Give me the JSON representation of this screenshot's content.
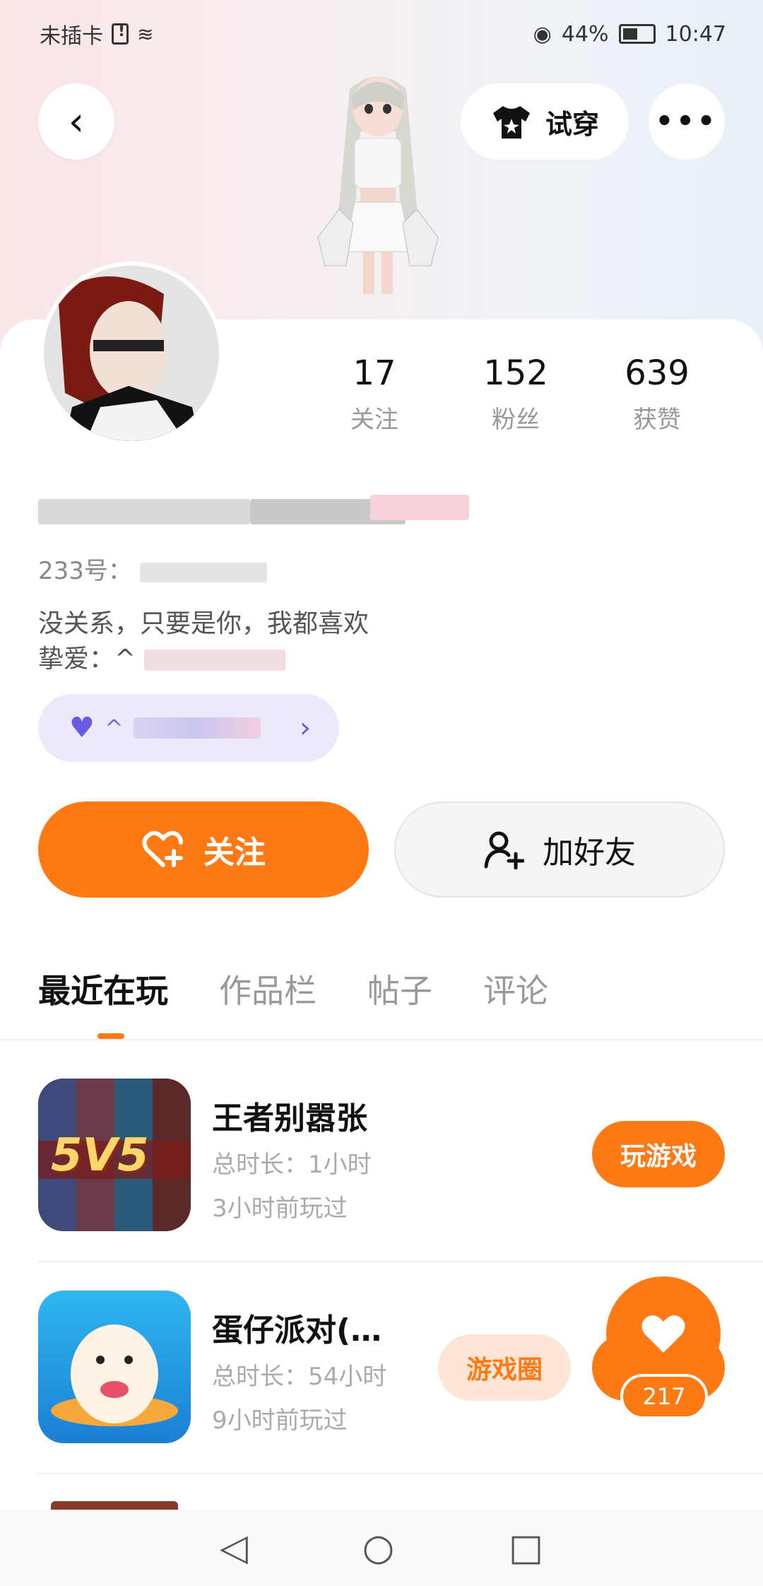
{
  "status_bar": {
    "carrier": "未插卡",
    "battery_percent": "44%",
    "time": "10:47"
  },
  "header": {
    "tryon_label": "试穿"
  },
  "stats": [
    {
      "value": "17",
      "label": "关注"
    },
    {
      "value": "152",
      "label": "粉丝"
    },
    {
      "value": "639",
      "label": "获赞"
    }
  ],
  "profile": {
    "id_label": "233号：",
    "bio_line1": "没关系，只要是你，我都喜欢",
    "bio_line2": "挚爱：^"
  },
  "friend_pill_prefix": "^",
  "actions": {
    "follow_label": "关注",
    "add_friend_label": "加好友"
  },
  "tabs": [
    {
      "label": "最近在玩",
      "active": true
    },
    {
      "label": "作品栏",
      "active": false
    },
    {
      "label": "帖子",
      "active": false
    },
    {
      "label": "评论",
      "active": false
    }
  ],
  "games": [
    {
      "title": "王者别嚣张",
      "total_time": "总时长：1小时",
      "last_played": "3小时前玩过",
      "button": "玩游戏",
      "icon_text": "5V5"
    },
    {
      "title": "蛋仔派对(…",
      "total_time": "总时长：54小时",
      "last_played": "9小时前玩过",
      "circle_button": "游戏圈"
    }
  ],
  "like_count": "217",
  "colors": {
    "accent": "#ff7a14",
    "purple": "#6a5ce0"
  }
}
